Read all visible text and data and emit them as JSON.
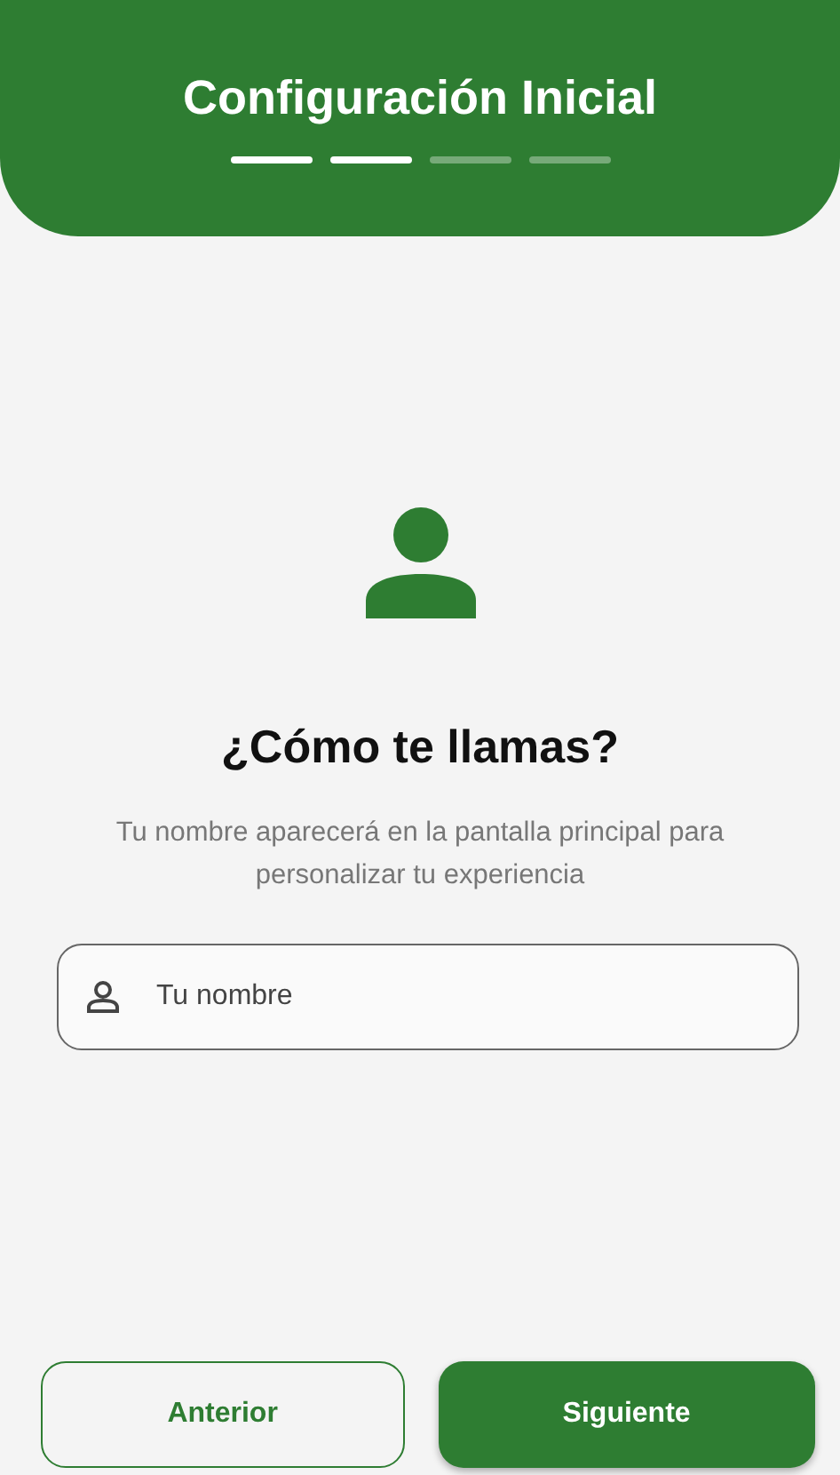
{
  "header": {
    "title": "Configuración Inicial",
    "steps": [
      {
        "done": true
      },
      {
        "done": true
      },
      {
        "done": false
      },
      {
        "done": false
      }
    ]
  },
  "question": "¿Cómo te llamas?",
  "description": "Tu nombre aparecerá en la pantalla principal para personalizar tu experiencia",
  "name_field": {
    "placeholder": "Tu nombre"
  },
  "buttons": [
    {
      "label": "Anterior",
      "kind": "outline"
    },
    {
      "label": "Siguiente",
      "kind": "filled"
    }
  ]
}
